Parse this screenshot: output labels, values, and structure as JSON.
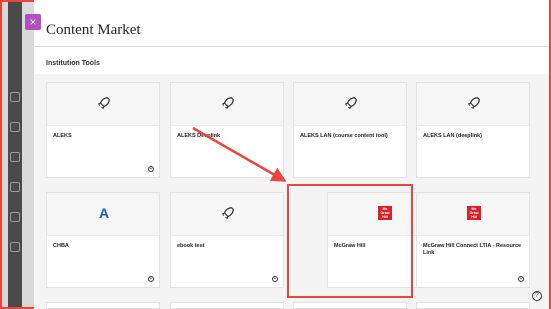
{
  "header": {
    "title": "Content Market",
    "close_label": "×"
  },
  "section": {
    "label": "Institution Tools"
  },
  "tools": [
    {
      "name": "ALEKS",
      "icon": "rocket-icon"
    },
    {
      "name": "ALEKS Deeplink",
      "icon": "rocket-icon"
    },
    {
      "name": "ALEKS LAN (course content tool)",
      "icon": "rocket-icon"
    },
    {
      "name": "ALEKS LAN (deeplink)",
      "icon": "rocket-icon"
    },
    {
      "name": "CHBA",
      "icon": "letter-a-icon",
      "glyph": "A"
    },
    {
      "name": "ebook test",
      "icon": "rocket-icon"
    },
    {
      "name": "McGraw Hill",
      "icon": "mcgraw-hill-logo",
      "logo_text": [
        "Mc",
        "Graw",
        "Hill"
      ]
    },
    {
      "name": "McGraw Hill Connect LTIA - Resource Link",
      "icon": "mcgraw-hill-logo",
      "logo_text": [
        "Mc",
        "Graw",
        "Hill"
      ]
    }
  ],
  "help": {
    "label": "?"
  },
  "colors": {
    "accent": "#b14fc5",
    "annotation": "#e8453c",
    "brand_red": "#d6232a",
    "chba_blue": "#1f5bb8"
  }
}
